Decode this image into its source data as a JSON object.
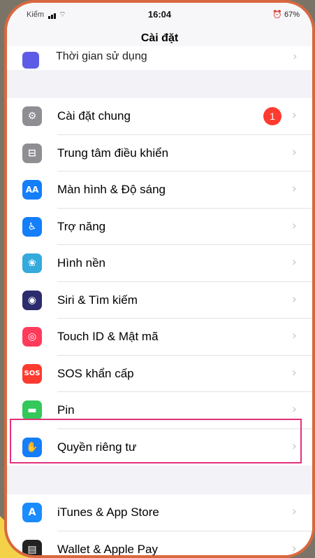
{
  "statusbar": {
    "carrier": "Kiểm",
    "time": "16:04",
    "battery": "67%"
  },
  "navbar": {
    "title": "Cài đặt"
  },
  "partial_row": {
    "label": "Thời gian sử dụng"
  },
  "chevron": "›",
  "group1": {
    "items": [
      {
        "label": "Cài đặt chung",
        "badge": "1",
        "icon_color": "#8e8e93",
        "icon": "gear-icon",
        "glyph": "⚙"
      },
      {
        "label": "Trung tâm điều khiển",
        "icon_color": "#8e8e93",
        "icon": "toggles-icon",
        "glyph": "⊟"
      },
      {
        "label": "Màn hình & Độ sáng",
        "icon_color": "#147efb",
        "icon": "aa-text-icon",
        "glyph": "AA"
      },
      {
        "label": "Trợ năng",
        "icon_color": "#147efb",
        "icon": "accessibility-icon",
        "glyph": "♿"
      },
      {
        "label": "Hình nền",
        "icon_color": "#35aadc",
        "icon": "flower-icon",
        "glyph": "❀"
      },
      {
        "label": "Siri & Tìm kiếm",
        "icon_color": "#2b2b6e",
        "icon": "siri-icon",
        "glyph": "◉"
      },
      {
        "label": "Touch ID & Mật mã",
        "icon_color": "#ff3b5c",
        "icon": "fingerprint-icon",
        "glyph": "◎"
      },
      {
        "label": "SOS khẩn cấp",
        "icon_color": "#ff3b30",
        "icon": "sos-icon",
        "glyph": "SOS"
      },
      {
        "label": "Pin",
        "icon_color": "#34c759",
        "icon": "battery-icon",
        "glyph": "▬"
      },
      {
        "label": "Quyền riêng tư",
        "icon_color": "#147efb",
        "icon": "hand-icon",
        "glyph": "✋"
      }
    ]
  },
  "group2": {
    "items": [
      {
        "label": "iTunes & App Store",
        "icon_color": "#1a8cff",
        "icon": "app-store-icon",
        "glyph": "A"
      },
      {
        "label": "Wallet & Apple Pay",
        "icon_color": "#222222",
        "icon": "wallet-icon",
        "glyph": "▤"
      }
    ]
  },
  "colors": {
    "highlight": "#e0317a",
    "frame": "#d9683f",
    "badge": "#ff3b30"
  }
}
